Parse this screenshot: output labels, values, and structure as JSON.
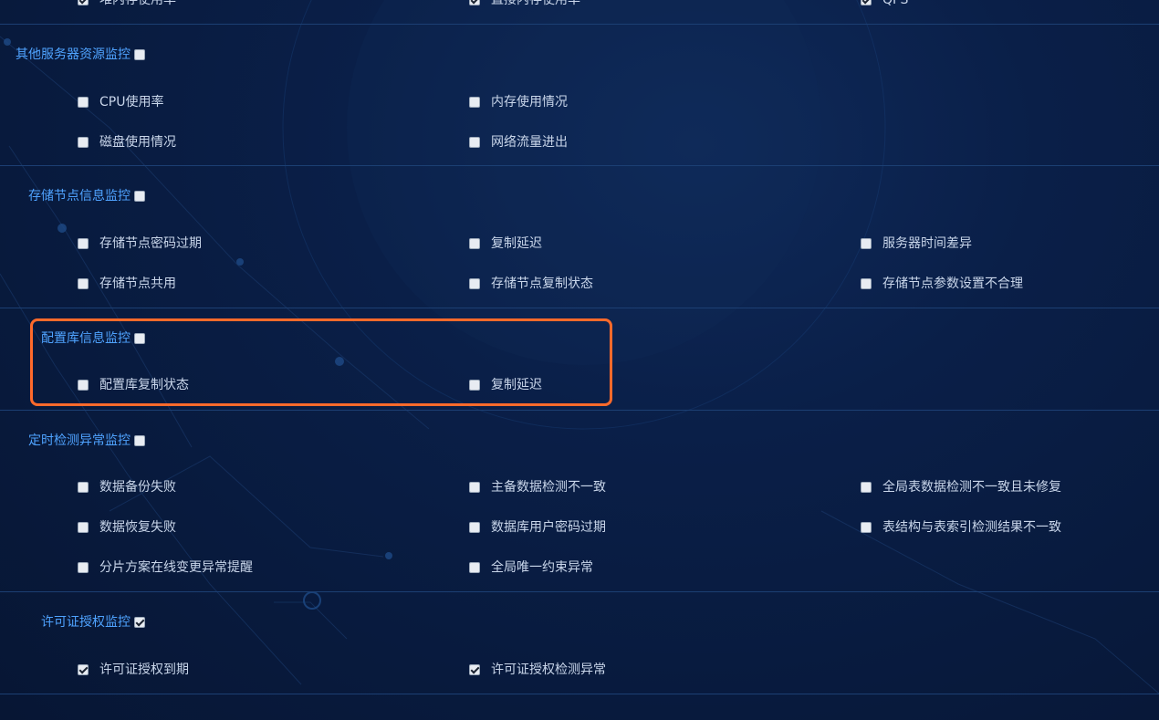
{
  "top_partial_row": {
    "items": [
      {
        "label": "堆内存使用率",
        "checked": true
      },
      {
        "label": "直接内存使用率",
        "checked": true
      },
      {
        "label": "QPS",
        "checked": true
      }
    ]
  },
  "sections": [
    {
      "title": "其他服务器资源监控",
      "checked": false,
      "items": [
        {
          "label": "CPU使用率",
          "checked": false
        },
        {
          "label": "内存使用情况",
          "checked": false
        },
        {
          "label": "磁盘使用情况",
          "checked": false
        },
        {
          "label": "网络流量进出",
          "checked": false
        }
      ]
    },
    {
      "title": "存储节点信息监控",
      "checked": false,
      "items": [
        {
          "label": "存储节点密码过期",
          "checked": false
        },
        {
          "label": "复制延迟",
          "checked": false
        },
        {
          "label": "服务器时间差异",
          "checked": false
        },
        {
          "label": "存储节点共用",
          "checked": false
        },
        {
          "label": "存储节点复制状态",
          "checked": false
        },
        {
          "label": "存储节点参数设置不合理",
          "checked": false
        }
      ]
    },
    {
      "title": "配置库信息监控",
      "checked": false,
      "items": [
        {
          "label": "配置库复制状态",
          "checked": false
        },
        {
          "label": "复制延迟",
          "checked": false
        }
      ]
    },
    {
      "title": "定时检测异常监控",
      "checked": false,
      "items": [
        {
          "label": "数据备份失败",
          "checked": false
        },
        {
          "label": "主备数据检测不一致",
          "checked": false
        },
        {
          "label": "全局表数据检测不一致且未修复",
          "checked": false
        },
        {
          "label": "数据恢复失败",
          "checked": false
        },
        {
          "label": "数据库用户密码过期",
          "checked": false
        },
        {
          "label": "表结构与表索引检测结果不一致",
          "checked": false
        },
        {
          "label": "分片方案在线变更异常提醒",
          "checked": false
        },
        {
          "label": "全局唯一约束异常",
          "checked": false
        }
      ]
    },
    {
      "title": "许可证授权监控",
      "checked": true,
      "items": [
        {
          "label": "许可证授权到期",
          "checked": true
        },
        {
          "label": "许可证授权检测异常",
          "checked": true
        }
      ]
    }
  ],
  "colors": {
    "background": "#0a1f48",
    "section_title": "#4fa3ff",
    "item_text": "#c9d6ea",
    "divider": "#1c3f73",
    "highlight": "#ff6a2b"
  }
}
